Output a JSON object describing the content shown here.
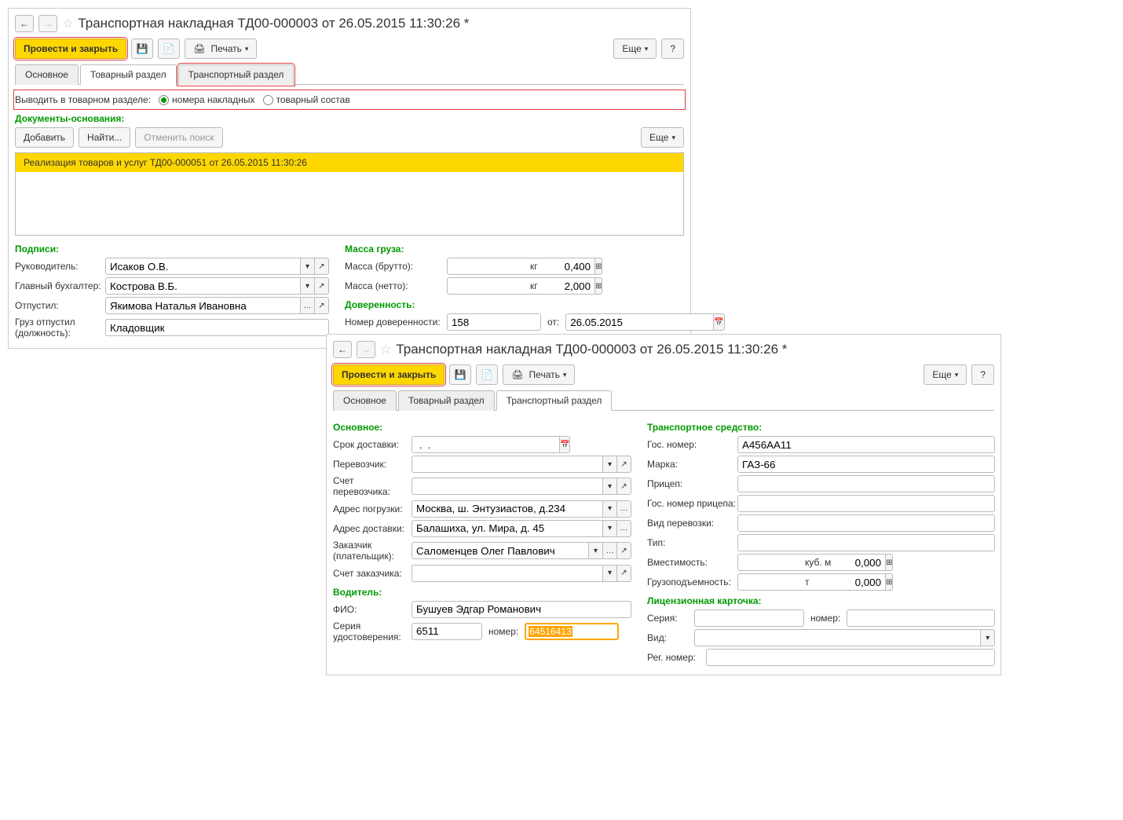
{
  "win1": {
    "title": "Транспортная накладная ТД00-000003 от 26.05.2015 11:30:26 *",
    "toolbar": {
      "post_close": "Провести и закрыть",
      "print": "Печать",
      "more": "Еще",
      "help": "?"
    },
    "tabs": [
      "Основное",
      "Товарный раздел",
      "Транспортный раздел"
    ],
    "radio_label": "Выводить в товарном разделе:",
    "radio1": "номера накладных",
    "radio2": "товарный состав",
    "docs_title": "Документы-основания:",
    "add": "Добавить",
    "find": "Найти...",
    "cancel_find": "Отменить поиск",
    "more2": "Еще",
    "doc_row": "Реализация товаров и услуг ТД00-000051 от 26.05.2015 11:30:26",
    "signs_title": "Подписи:",
    "sign_head_lbl": "Руководитель:",
    "sign_head_val": "Исаков О.В.",
    "sign_acc_lbl": "Главный бухгалтер:",
    "sign_acc_val": "Кострова В.Б.",
    "sign_rel_lbl": "Отпустил:",
    "sign_rel_val": "Якимова Наталья Ивановна",
    "sign_cargo_lbl": "Груз отпустил (должность):",
    "sign_cargo_val": "Кладовщик",
    "mass_title": "Масса груза:",
    "mass_gross_lbl": "Масса (брутто):",
    "mass_gross_val": "0,400",
    "mass_net_lbl": "Масса (нетто):",
    "mass_net_val": "2,000",
    "kg": "кг",
    "dov_title": "Доверенность:",
    "dov_num_lbl": "Номер доверенности:",
    "dov_num_val": "158",
    "dov_from": "от:",
    "dov_date": "26.05.2015"
  },
  "win2": {
    "title": "Транспортная накладная ТД00-000003 от 26.05.2015 11:30:26 *",
    "toolbar": {
      "post_close": "Провести и закрыть",
      "print": "Печать",
      "more": "Еще",
      "help": "?"
    },
    "tabs": [
      "Основное",
      "Товарный раздел",
      "Транспортный раздел"
    ],
    "main_title": "Основное:",
    "delivery_lbl": "Срок доставки:",
    "delivery_val": " .  .",
    "carrier_lbl": "Перевозчик:",
    "carrier_acc_lbl": "Счет перевозчика:",
    "load_addr_lbl": "Адрес погрузки:",
    "load_addr_val": "Москва, ш. Энтузиастов, д.234",
    "deliv_addr_lbl": "Адрес доставки:",
    "deliv_addr_val": "Балашиха, ул. Мира, д. 45",
    "customer_lbl": "Заказчик (плательщик):",
    "customer_val": "Саломенцев Олег Павлович",
    "cust_acc_lbl": "Счет заказчика:",
    "vehicle_title": "Транспортное средство:",
    "gos_lbl": "Гос. номер:",
    "gos_val": "А456АА11",
    "brand_lbl": "Марка:",
    "brand_val": "ГАЗ-66",
    "trailer_lbl": "Прицеп:",
    "trailer_gos_lbl": "Гос. номер прицепа:",
    "transport_type_lbl": "Вид перевозки:",
    "type_lbl": "Тип:",
    "capacity_lbl": "Вместимость:",
    "capacity_val": "0,000",
    "cubm": "куб. м",
    "load_lbl": "Грузоподъемность:",
    "load_val": "0,000",
    "ton": "т",
    "driver_title": "Водитель:",
    "fio_lbl": "ФИО:",
    "fio_val": "Бушуев Эдгар Романович",
    "cert_lbl": "Серия удостоверения:",
    "cert_val": "6511",
    "num_lbl": "номер:",
    "num_val": "64516413",
    "lic_title": "Лицензионная карточка:",
    "lic_series_lbl": "Серия:",
    "lic_num_lbl": "номер:",
    "lic_type_lbl": "Вид:",
    "lic_reg_lbl": "Рег. номер:"
  }
}
